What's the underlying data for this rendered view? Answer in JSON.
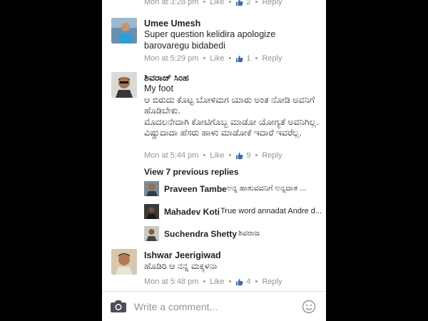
{
  "comments": [
    {
      "name": "",
      "text": "",
      "time": "Mon at 3:28 pm",
      "like_label": "Like",
      "like_count": "2",
      "reply_label": "Reply"
    },
    {
      "name": "Umee Umesh",
      "text": "Super question kelidira apologize barovaregu bidabedi",
      "time": "Mon at 5:29 pm",
      "like_label": "Like",
      "like_count": "1",
      "reply_label": "Reply"
    },
    {
      "name": "ಶಿವರಾಜ್ ಸಿಂಹ",
      "text": "My foot\nಆ ಬಿರುದು ಕೊಟ್ಟ ಬೋಳಿಮಗ ಯಾರು ಅಂತ ನೋಡಿ ಅವನಿಗೆ ಹೊಡಿಬೇಕು.\nಮೊದಲನೇದಾಗಿ ಕೋಟಿಗೊಬ್ಬ ಮಾಡೋ ಯೋಗ್ಯತೆ ಅವನಿಗಿಲ್ಲ. ವಿಷ್ಣುದಾದಾ ಹೆಸರು ಹಾಳು ಮಾಡೋಕೆ ಇದಾರೆ ಇವರೆಲ್ಲ.",
      "time": "Mon at 5:44 pm",
      "like_label": "Like",
      "like_count": "9",
      "reply_label": "Reply"
    },
    {
      "name": "Ishwar Jeerigiwad",
      "text": "ಹೊಡಿರಿ ಆ ನನ್ನ ಮಕ್ಕಳನಾ",
      "time": "Mon at 5:48 pm",
      "like_label": "Like",
      "like_count": "4",
      "reply_label": "Reply"
    }
  ],
  "view_previous": "View 7 previous replies",
  "replies": [
    {
      "name": "Praveen Tambe",
      "text": "ಅನ್ನ ಹಾಕುವವನಿಗೆ ಅನ್ನದಾತ ..."
    },
    {
      "name": "Mahadev Koti",
      "text": "True word annadat Andre d..."
    },
    {
      "name": "Suchendra Shetty",
      "text": "ಶಿವರಾಜ"
    }
  ],
  "composer": {
    "placeholder": "Write a comment...",
    "camera_icon": "camera-icon",
    "emoji_icon": "smiley-icon"
  },
  "colors": {
    "text": "#1d2129",
    "meta": "#90949c",
    "like_blue": "#4267b2",
    "background": "#ffffff"
  }
}
